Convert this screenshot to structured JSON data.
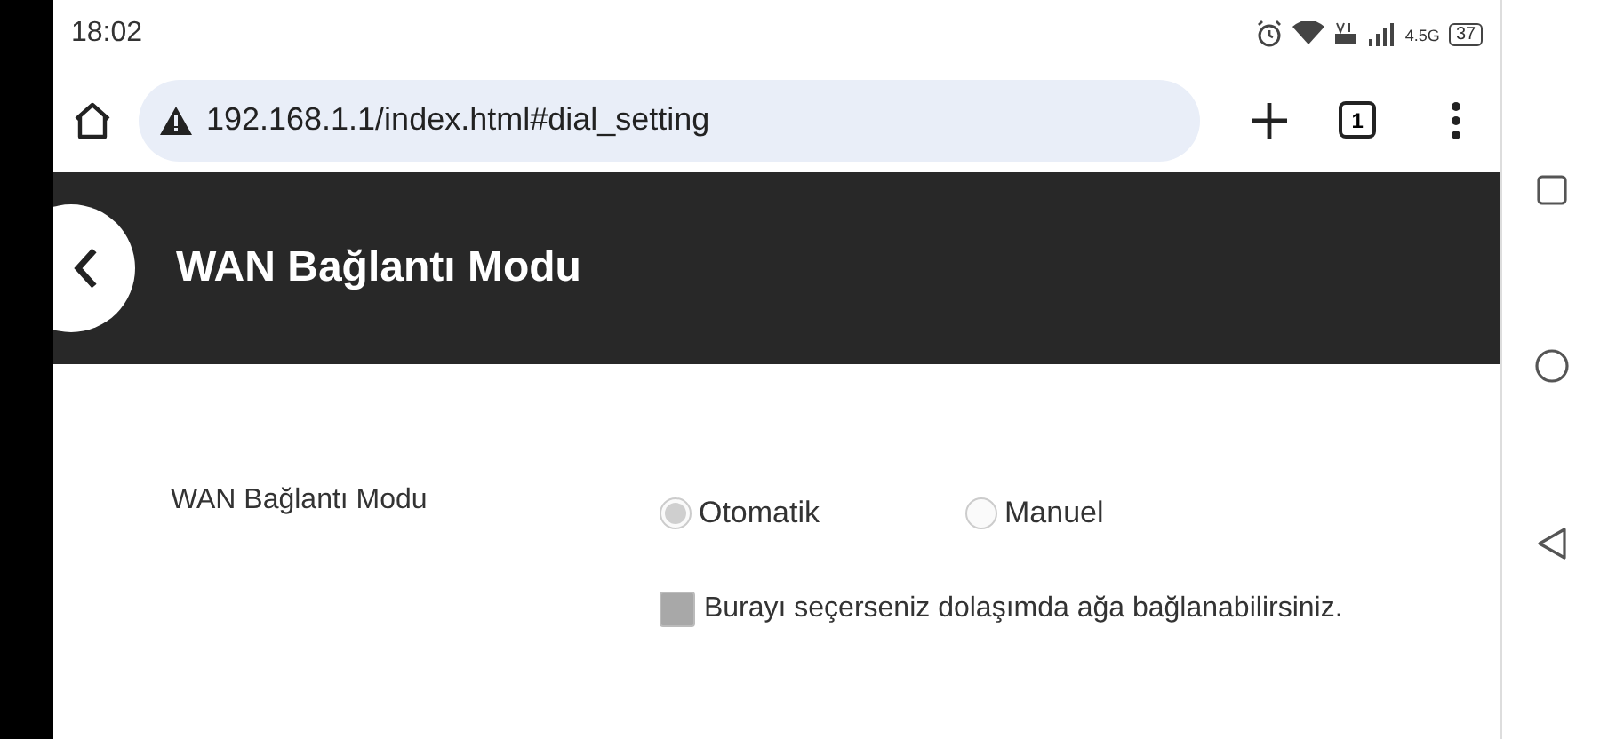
{
  "status_bar": {
    "time": "18:02",
    "network_type": "4.5G",
    "battery": "37"
  },
  "browser": {
    "url": "192.168.1.1/index.html#dial_setting",
    "tab_count": "1"
  },
  "header": {
    "title": "WAN Bağlantı Modu"
  },
  "form": {
    "label": "WAN Bağlantı Modu",
    "options": [
      {
        "label": "Otomatik",
        "selected": true,
        "disabled": true
      },
      {
        "label": "Manuel",
        "selected": false,
        "disabled": true
      }
    ],
    "roaming": {
      "label": "Burayı seçerseniz dolaşımda ağa bağlanabilirsiniz.",
      "checked": false,
      "disabled": true
    }
  }
}
